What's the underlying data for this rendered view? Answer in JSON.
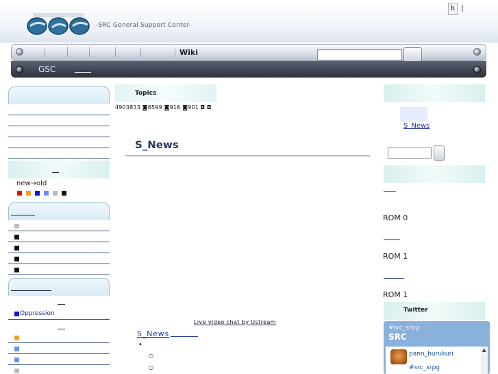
{
  "header": {
    "logo_text": "GSC",
    "tagline": "-SRC General Support Center-",
    "lang_button": "h",
    "lang_separator": "|"
  },
  "nav": {
    "wiki_label": "Wiki",
    "search_placeholder": "",
    "gsc_label": "GSC"
  },
  "left_sidebar": {
    "sort_text": "new→old",
    "color_legend": [
      "#dd1111",
      "#f0a020",
      "#1111dd",
      "#6f8fee",
      "#bbbbbb",
      "#111111"
    ],
    "list2_squares": [
      "#bbbbbb",
      "#111111",
      "#111111",
      "#111111",
      "#111111"
    ],
    "oppression_label": "Oppression",
    "oppression_color": "#1111dd",
    "list3_squares": [
      "#f0a020",
      "#6f8fee",
      "#6f8fee",
      "#bbbbbb"
    ]
  },
  "center": {
    "topics_label": "Topics",
    "counter_text": "4903833 ◙6599 ◙916 ◙901 ◘ ◘",
    "snews_title": "S_News",
    "ustream_link": "Live video chat by Ustream",
    "snews_link": "S_News",
    "bullet": "•",
    "circle": "○"
  },
  "right_sidebar": {
    "snews_link": "S_News",
    "rom_rows": [
      "ROM  0",
      "ROM  1",
      "ROM  1"
    ],
    "twitter_label": "Twitter"
  },
  "twitter_widget": {
    "hashtag": "#src_srpg",
    "title": "SRC",
    "tweet_user": "pann_burukuri",
    "tweet_text": "#src_srpg",
    "scroll_up": "▲"
  }
}
